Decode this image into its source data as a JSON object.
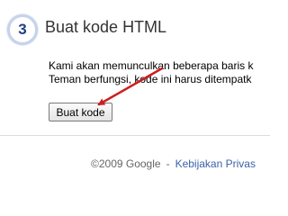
{
  "step": {
    "number": "3",
    "title": "Buat kode HTML"
  },
  "description": {
    "line1": "Kami akan memunculkan beberapa baris k",
    "line2": "Teman berfungsi, kode ini harus ditempatk"
  },
  "button": {
    "label": "Buat kode"
  },
  "annotation": {
    "arrow_color": "#cc1f1f"
  },
  "footer": {
    "copyright": "©2009 Google",
    "separator": "-",
    "link_label": "Kebijakan Privas"
  }
}
